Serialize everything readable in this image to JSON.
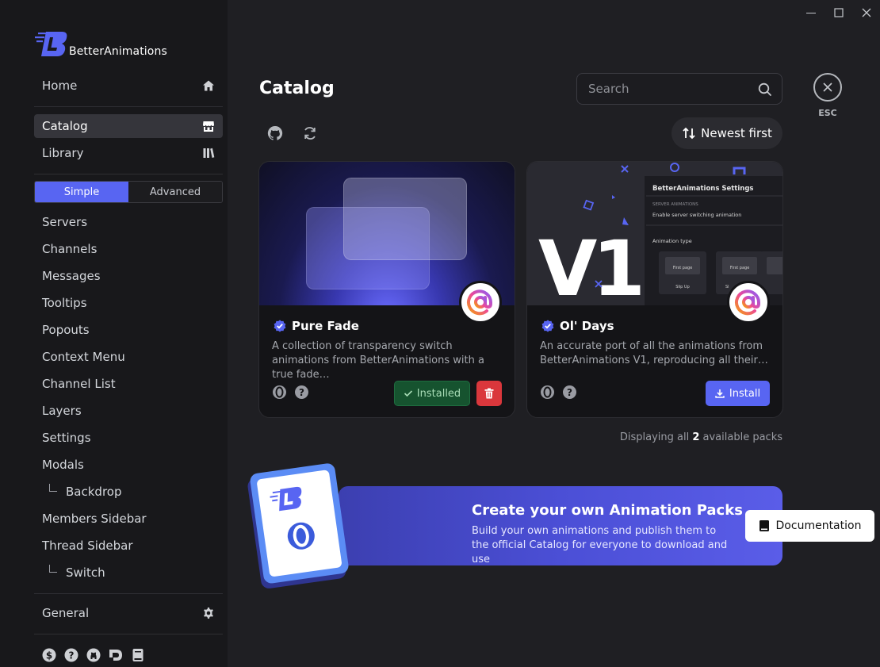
{
  "app": {
    "name": "BetterAnimations"
  },
  "sidebar": {
    "home": "Home",
    "catalog": "Catalog",
    "library": "Library",
    "mode_simple": "Simple",
    "mode_advanced": "Advanced",
    "items": [
      "Servers",
      "Channels",
      "Messages",
      "Tooltips",
      "Popouts",
      "Context Menu",
      "Channel List",
      "Layers",
      "Settings",
      "Modals",
      "Backdrop",
      "Members Sidebar",
      "Thread Sidebar",
      "Switch"
    ],
    "general": "General",
    "footer_icons": [
      "dollar-icon",
      "help-icon",
      "github-icon",
      "discord-icon",
      "book-icon"
    ]
  },
  "main": {
    "title": "Catalog",
    "search_placeholder": "Search",
    "esc_label": "ESC",
    "sort_label": "Newest first",
    "cards": [
      {
        "title": "Pure Fade",
        "description": "A collection of transparency switch animations from BetterAnimations with a true fade…",
        "action": "Installed"
      },
      {
        "title": "Ol' Days",
        "description": "An accurate port of all the animations from BetterAnimations V1, reproducing all their…",
        "action": "Install",
        "banner": {
          "big_text": "V1",
          "settings_title": "BetterAnimations Settings",
          "server_animations": "SERVER ANIMATIONS",
          "enable_switch": "Enable server switching animation",
          "animation_type": "Animation type",
          "first_page": "First page",
          "slip_up": "Slip Up",
          "partial": "Sl"
        }
      }
    ],
    "count_prefix": "Displaying all",
    "count_number": "2",
    "count_suffix": "available packs",
    "promo": {
      "title": "Create your own Animation Packs",
      "subtitle": "Build your own animations and publish them to the official Catalog for everyone to download and use",
      "button": "Documentation"
    }
  },
  "colors": {
    "accent": "#5865f2",
    "installed": "#16532f",
    "danger": "#da373c"
  }
}
